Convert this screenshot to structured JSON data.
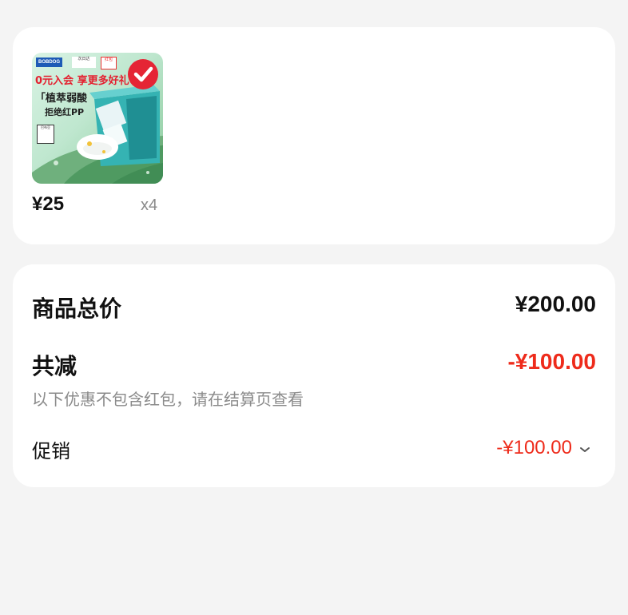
{
  "product": {
    "price": "¥25",
    "quantity": "x4",
    "image": {
      "brand_tag": "BOBDOG",
      "tag1": "次日达",
      "tag2": "红包",
      "promo": "0元入会 享更多好礼",
      "line1": "「植萃弱酸",
      "line2": "拒绝红PP",
      "small_box": "巴布豆"
    }
  },
  "summary": {
    "total_label": "商品总价",
    "total_value": "¥200.00",
    "discount_label": "共减",
    "discount_value": "-¥100.00",
    "note": "以下优惠不包含红包，请在结算页查看",
    "promo_label": "促销",
    "promo_value": "-¥100.00"
  },
  "colors": {
    "accent_red": "#ee2b1b",
    "background": "#f4f4f4",
    "card": "#ffffff",
    "muted_text": "#8b8b8b"
  },
  "icons": {
    "promo_expand": "chevron-down-icon",
    "image_check": "checkmark-icon"
  }
}
